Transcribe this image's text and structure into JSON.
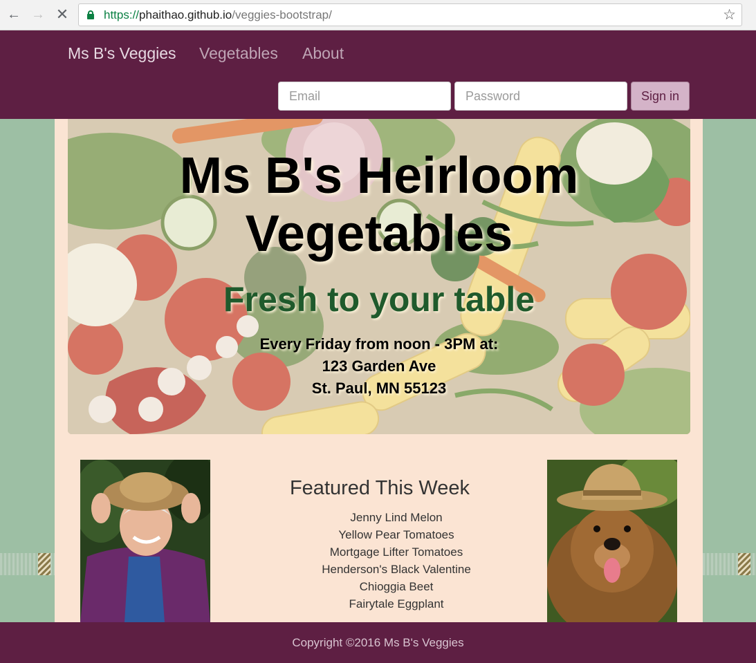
{
  "browser": {
    "url_scheme": "https://",
    "url_host": "phaithao.github.io",
    "url_path": "/veggies-bootstrap/",
    "icons": [
      "back-arrow-icon",
      "forward-arrow-icon",
      "stop-loading-icon",
      "lock-icon",
      "bookmark-star-icon"
    ]
  },
  "navbar": {
    "brand": "Ms B's Veggies",
    "links": [
      "Vegetables",
      "About"
    ],
    "email_placeholder": "Email",
    "password_placeholder": "Password",
    "signin_label": "Sign in"
  },
  "hero": {
    "title_line1": "Ms B's Heirloom",
    "title_line2": "Vegetables",
    "subtitle": "Fresh to your table",
    "schedule": "Every Friday from noon - 3PM at:",
    "street": "123 Garden Ave",
    "city": "St. Paul, MN 55123"
  },
  "featured": {
    "title": "Featured This Week",
    "items": [
      "Jenny Lind Melon",
      "Yellow Pear Tomatoes",
      "Mortgage Lifter Tomatoes",
      "Henderson's Black Valentine",
      "Chioggia Beet",
      "Fairytale Eggplant"
    ]
  },
  "footer": {
    "copyright": "Copyright ©2016 Ms B's Veggies"
  },
  "colors": {
    "navbar": "#5e1f43",
    "page_background": "#9dbfa4",
    "container": "#fbe4d3",
    "subtitle_green": "#1f5a2c",
    "signin_button": "#d4b3c8"
  }
}
